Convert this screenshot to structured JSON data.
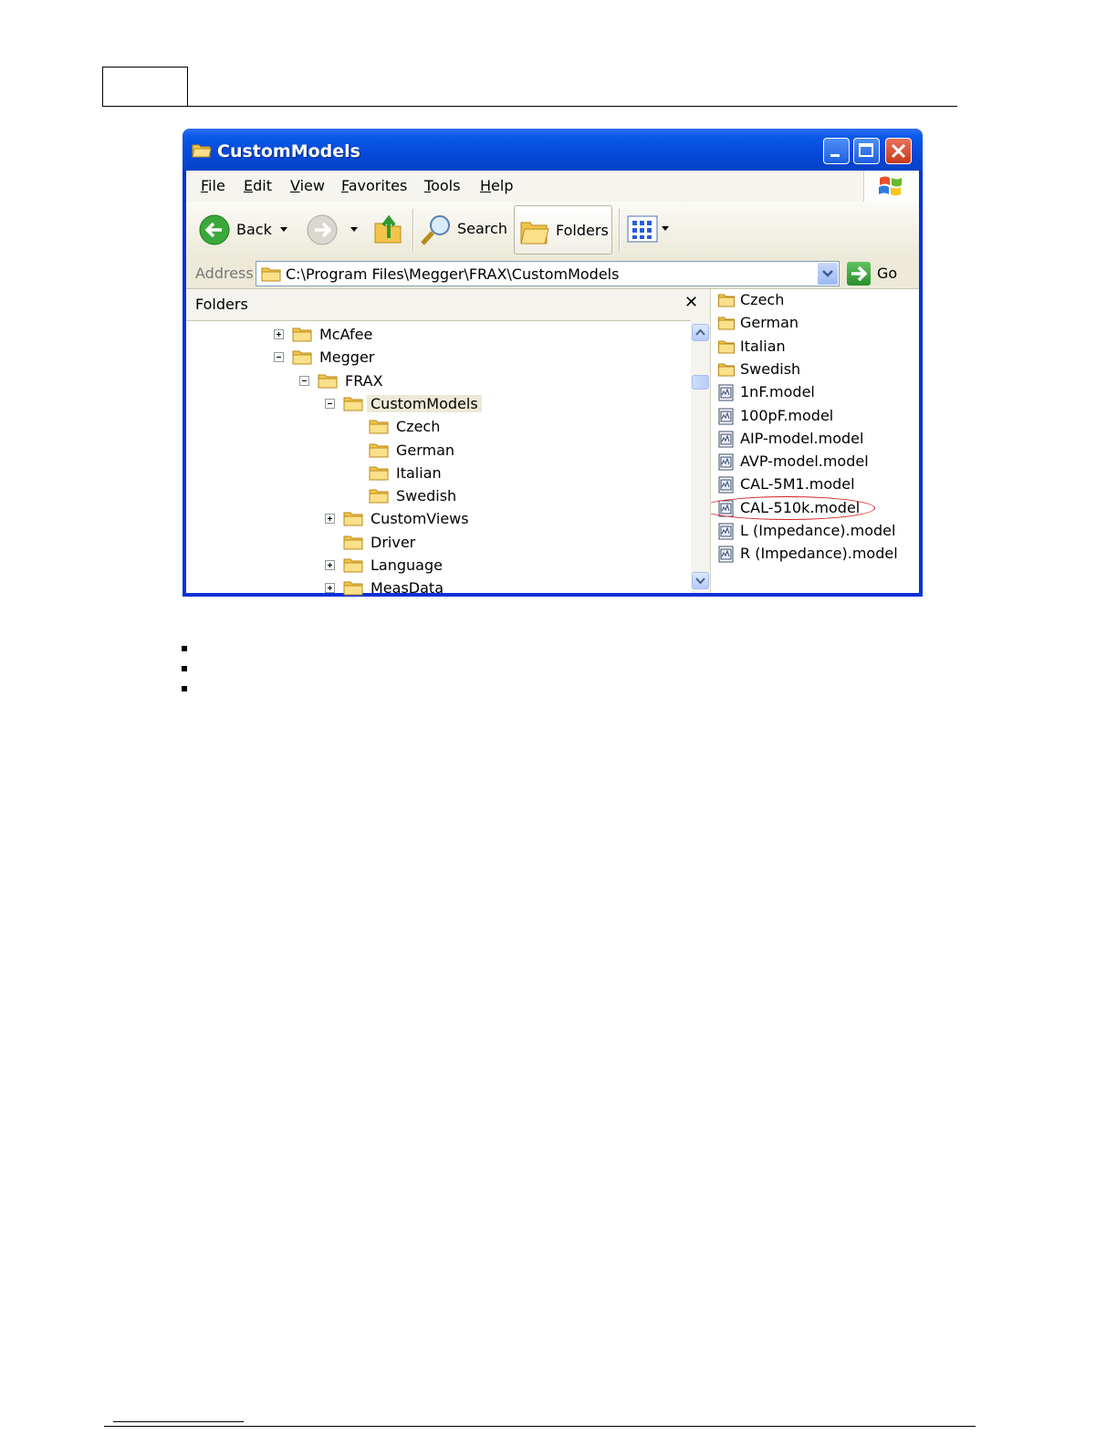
{
  "window": {
    "title": "CustomModels",
    "menu": [
      "File",
      "Edit",
      "View",
      "Favorites",
      "Tools",
      "Help"
    ],
    "toolbar": {
      "back_label": "Back",
      "search_label": "Search",
      "folders_label": "Folders"
    },
    "address": {
      "label": "Address",
      "value": "C:\\Program Files\\Megger\\FRAX\\CustomModels",
      "go_label": "Go"
    },
    "folders_pane": {
      "title": "Folders",
      "close_glyph": "✕",
      "tree": [
        {
          "label": "McAfee",
          "expander": "plus"
        },
        {
          "label": "Megger",
          "expander": "minus"
        },
        {
          "label": "FRAX",
          "expander": "minus"
        },
        {
          "label": "CustomModels",
          "expander": "minus",
          "selected": true
        },
        {
          "label": "Czech",
          "expander": "none"
        },
        {
          "label": "German",
          "expander": "none"
        },
        {
          "label": "Italian",
          "expander": "none"
        },
        {
          "label": "Swedish",
          "expander": "none"
        },
        {
          "label": "CustomViews",
          "expander": "plus"
        },
        {
          "label": "Driver",
          "expander": "none"
        },
        {
          "label": "Language",
          "expander": "plus"
        },
        {
          "label": "MeasData",
          "expander": "plus"
        }
      ]
    },
    "files": [
      {
        "name": "Czech",
        "type": "folder"
      },
      {
        "name": "German",
        "type": "folder"
      },
      {
        "name": "Italian",
        "type": "folder"
      },
      {
        "name": "Swedish",
        "type": "folder"
      },
      {
        "name": "1nF.model",
        "type": "model"
      },
      {
        "name": "100pF.model",
        "type": "model"
      },
      {
        "name": "AIP-model.model",
        "type": "model"
      },
      {
        "name": "AVP-model.model",
        "type": "model"
      },
      {
        "name": "CAL-5M1.model",
        "type": "model"
      },
      {
        "name": "CAL-510k.model",
        "type": "model",
        "highlighted": true
      },
      {
        "name": "L (Impedance).model",
        "type": "model"
      },
      {
        "name": "R (Impedance).model",
        "type": "model"
      }
    ]
  },
  "colors": {
    "titlebar": "#0549d8",
    "highlight_ring": "#d02020",
    "folder": "#f3c44a"
  }
}
